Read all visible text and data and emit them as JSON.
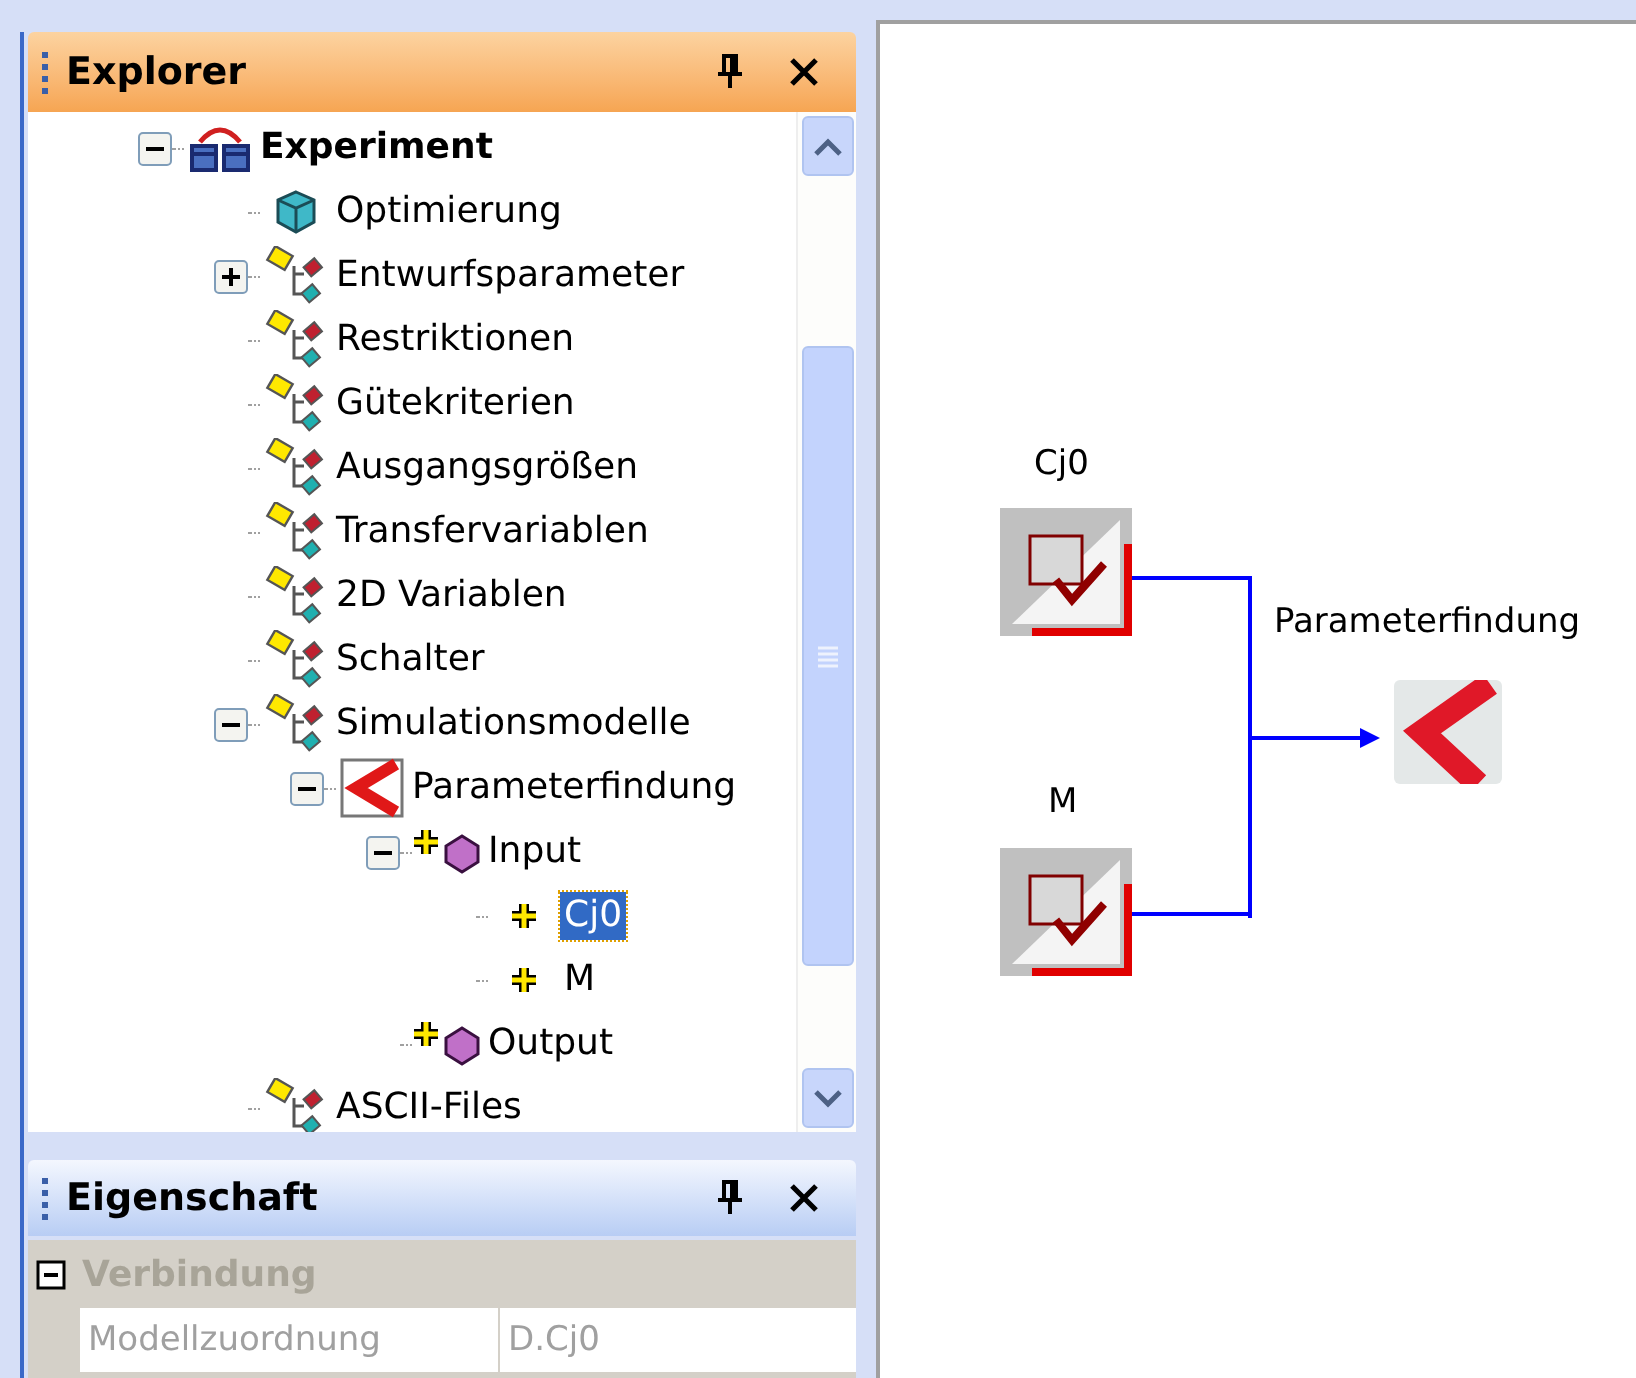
{
  "explorer": {
    "title": "Explorer",
    "tree": [
      {
        "label": "Experiment",
        "kind": "experiment",
        "expanded": true,
        "selected": false,
        "children": [
          {
            "label": "Optimierung",
            "kind": "optimization",
            "selected": false
          },
          {
            "label": "Entwurfsparameter",
            "kind": "group",
            "expanded": false,
            "selected": false
          },
          {
            "label": "Restriktionen",
            "kind": "group",
            "selected": false
          },
          {
            "label": "Gütekriterien",
            "kind": "group",
            "selected": false
          },
          {
            "label": "Ausgangsgrößen",
            "kind": "group",
            "selected": false
          },
          {
            "label": "Transfervariablen",
            "kind": "group",
            "selected": false
          },
          {
            "label": "2D Variablen",
            "kind": "group",
            "selected": false
          },
          {
            "label": "Schalter",
            "kind": "group",
            "selected": false
          },
          {
            "label": "Simulationsmodelle",
            "kind": "group",
            "expanded": true,
            "selected": false,
            "children": [
              {
                "label": "Parameterfindung",
                "kind": "model",
                "expanded": true,
                "selected": false,
                "children": [
                  {
                    "label": "Input",
                    "kind": "port",
                    "expanded": true,
                    "selected": false,
                    "children": [
                      {
                        "label": "Cj0",
                        "kind": "variable",
                        "selected": true
                      },
                      {
                        "label": "M",
                        "kind": "variable",
                        "selected": false
                      }
                    ]
                  },
                  {
                    "label": "Output",
                    "kind": "port",
                    "selected": false
                  }
                ]
              }
            ]
          },
          {
            "label": "ASCII-Files",
            "kind": "group",
            "selected": false
          }
        ]
      }
    ]
  },
  "properties": {
    "title": "Eigenschaft",
    "categories": [
      {
        "label": "Verbindung",
        "expanded": true,
        "rows": [
          {
            "name": "Modellzuordnung",
            "value": "D.Cj0"
          }
        ]
      }
    ]
  },
  "diagram": {
    "nodes": [
      {
        "label": "Cj0",
        "kind": "input"
      },
      {
        "label": "M",
        "kind": "input"
      },
      {
        "label": "Parameterfindung",
        "kind": "model"
      }
    ]
  }
}
